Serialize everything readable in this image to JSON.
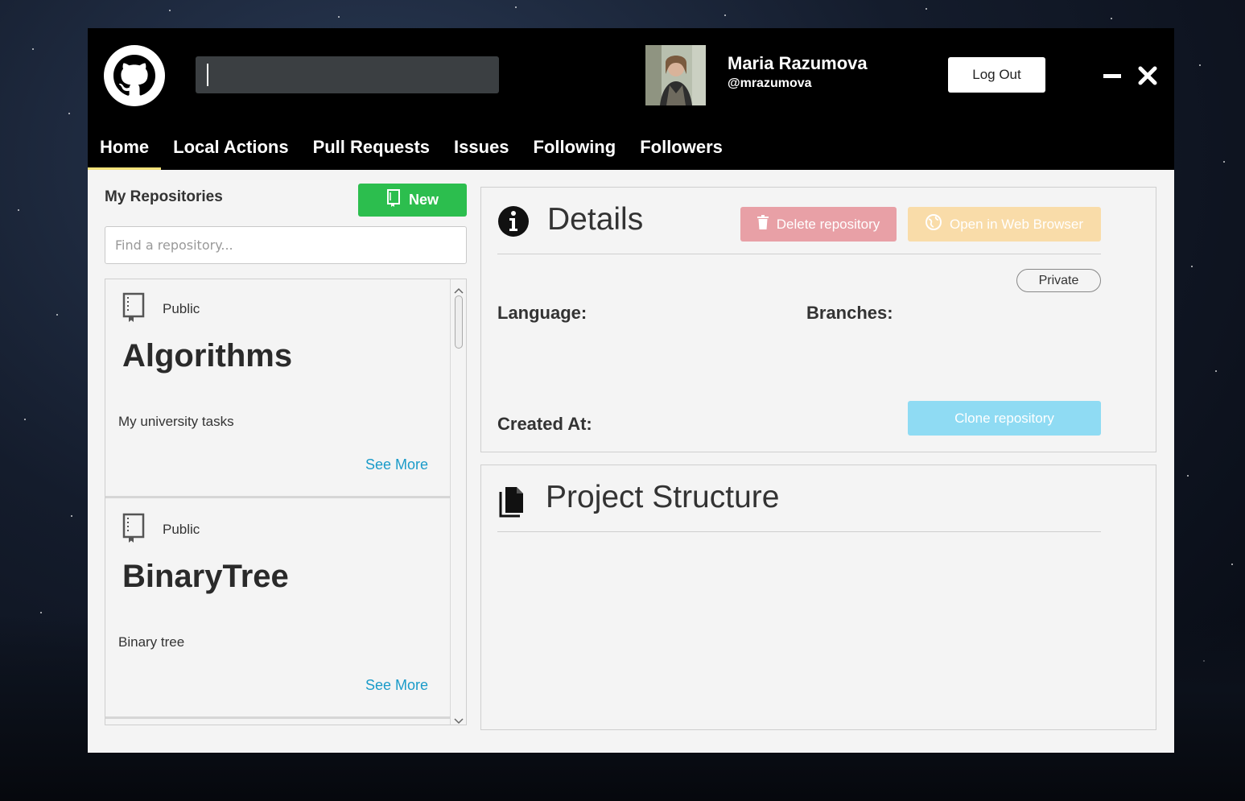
{
  "header": {
    "search": {
      "value": "",
      "placeholder": ""
    },
    "user": {
      "name": "Maria Razumova",
      "handle": "@mrazumova"
    },
    "logout_label": "Log Out"
  },
  "nav": {
    "tabs": [
      {
        "label": "Home",
        "active": true
      },
      {
        "label": "Local Actions",
        "active": false
      },
      {
        "label": "Pull Requests",
        "active": false
      },
      {
        "label": "Issues",
        "active": false
      },
      {
        "label": "Following",
        "active": false
      },
      {
        "label": "Followers",
        "active": false
      }
    ]
  },
  "repositories": {
    "heading": "My Repositories",
    "new_label": "New",
    "search_placeholder": "Find a repository...",
    "items": [
      {
        "visibility": "Public",
        "name": "Algorithms",
        "description": "My university tasks",
        "more_label": "See More"
      },
      {
        "visibility": "Public",
        "name": "BinaryTree",
        "description": "Binary tree",
        "more_label": "See More"
      }
    ]
  },
  "details": {
    "title": "Details",
    "delete_label": "Delete repository",
    "open_label": "Open in Web Browser",
    "visibility_badge": "Private",
    "language_label": "Language:",
    "branches_label": "Branches:",
    "created_label": "Created At:",
    "clone_label": "Clone repository"
  },
  "structure": {
    "title": "Project Structure"
  },
  "colors": {
    "accent_green": "#2cbe4e",
    "delete_red": "#e8a0a6",
    "open_orange": "#f9dca9",
    "clone_blue": "#8fdbf3",
    "link_blue": "#1a9bc9",
    "tab_underline": "#f3e27a"
  },
  "icons": {
    "logo": "github-logo-icon",
    "book": "repo-book-icon",
    "info": "info-icon",
    "file": "file-icon",
    "trash": "trash-icon",
    "globe": "globe-icon",
    "minimize": "minimize-icon",
    "close": "close-icon"
  }
}
